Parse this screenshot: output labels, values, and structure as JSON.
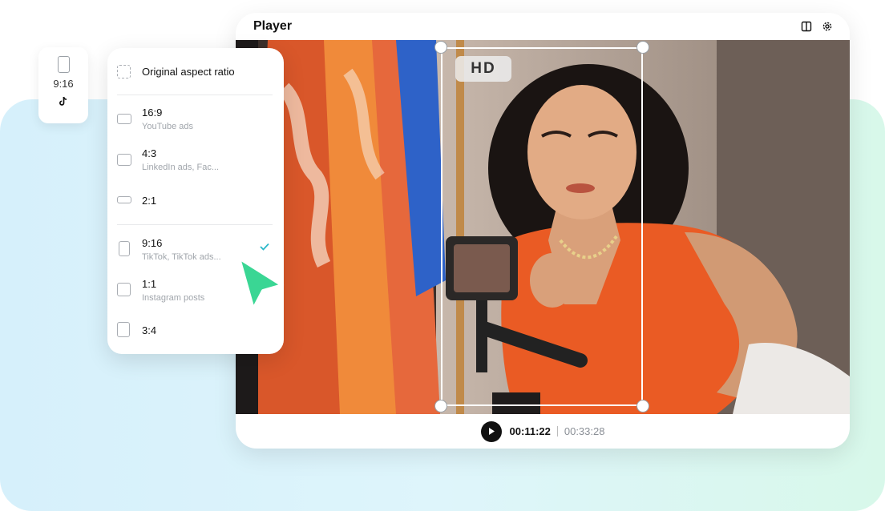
{
  "chip": {
    "label": "9:16",
    "icon": "tiktok-icon"
  },
  "player": {
    "title": "Player",
    "badge": "HD",
    "time_current": "00:11:22",
    "time_total": "00:33:28",
    "icons": [
      "split-view-icon",
      "settings-gear-icon",
      "play-icon"
    ]
  },
  "menu": {
    "items": [
      {
        "label": "Original aspect ratio",
        "sub": ""
      },
      {
        "label": "16:9",
        "sub": "YouTube ads"
      },
      {
        "label": "4:3",
        "sub": "LinkedIn ads, Fac..."
      },
      {
        "label": "2:1",
        "sub": ""
      },
      {
        "label": "9:16",
        "sub": "TikTok, TikTok ads...",
        "selected": true
      },
      {
        "label": "1:1",
        "sub": "Instagram posts"
      },
      {
        "label": "3:4",
        "sub": ""
      }
    ]
  },
  "colors": {
    "accent": "#3ad694",
    "check": "#2bb8c9",
    "bg_left": "#d6f0fb",
    "bg_right": "#d8f8ea"
  }
}
